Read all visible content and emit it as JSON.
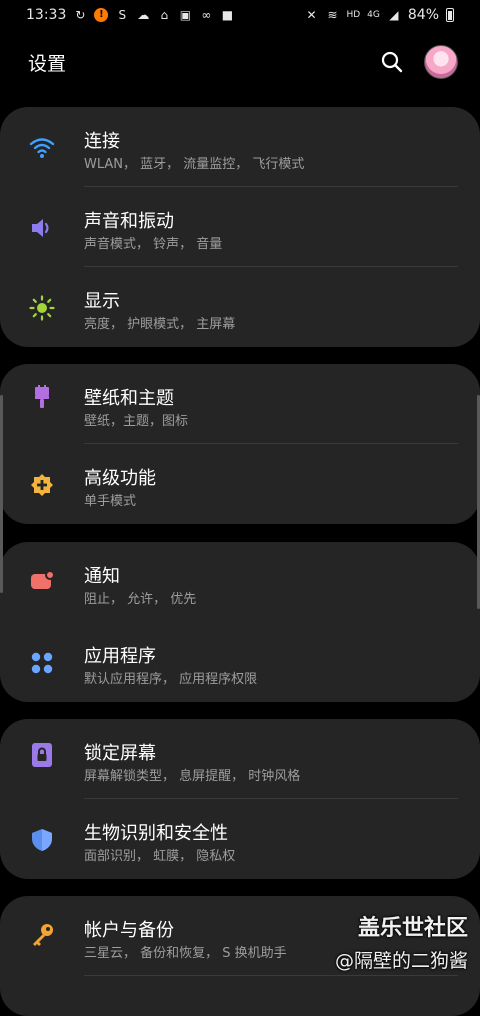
{
  "status_bar": {
    "time": "13:33",
    "network_label": "HD",
    "network_type": "4G",
    "battery": "84%"
  },
  "header": {
    "title": "设置"
  },
  "cards": [
    {
      "items": [
        {
          "title": "连接",
          "subtitle": "WLAN， 蓝牙， 流量监控， 飞行模式",
          "icon": "wifi-icon",
          "color": "#3ea0ff"
        },
        {
          "title": "声音和振动",
          "subtitle": "声音模式， 铃声， 音量",
          "icon": "volume-icon",
          "color": "#8c7cf0"
        },
        {
          "title": "显示",
          "subtitle": "亮度， 护眼模式， 主屏幕",
          "icon": "brightness-icon",
          "color": "#a4d63a"
        }
      ]
    },
    {
      "items": [
        {
          "title": "壁纸和主题",
          "subtitle": "壁纸，主题，图标",
          "icon": "brush-icon",
          "color": "#b36ee0"
        },
        {
          "title": "高级功能",
          "subtitle": "单手模式",
          "icon": "gear-plus-icon",
          "color": "#f2b43c"
        }
      ]
    },
    {
      "items": [
        {
          "title": "通知",
          "subtitle": "阻止， 允许， 优先",
          "icon": "notification-icon",
          "color": "#f0706a"
        },
        {
          "title": "应用程序",
          "subtitle": "默认应用程序， 应用程序权限",
          "icon": "apps-icon",
          "color": "#6aa6ff"
        }
      ]
    },
    {
      "items": [
        {
          "title": "锁定屏幕",
          "subtitle": "屏幕解锁类型， 息屏提醒， 时钟风格",
          "icon": "lock-icon",
          "color": "#9a7ae6"
        },
        {
          "title": "生物识别和安全性",
          "subtitle": "面部识别， 虹膜， 隐私权",
          "icon": "shield-icon",
          "color": "#5c8ef0"
        }
      ]
    },
    {
      "items": [
        {
          "title": "帐户与备份",
          "subtitle": "三星云， 备份和恢复， S 换机助手",
          "icon": "key-icon",
          "color": "#f2a533"
        }
      ]
    }
  ],
  "watermark": {
    "line1": "盖乐世社区",
    "line2": "@隔壁的二狗酱"
  }
}
